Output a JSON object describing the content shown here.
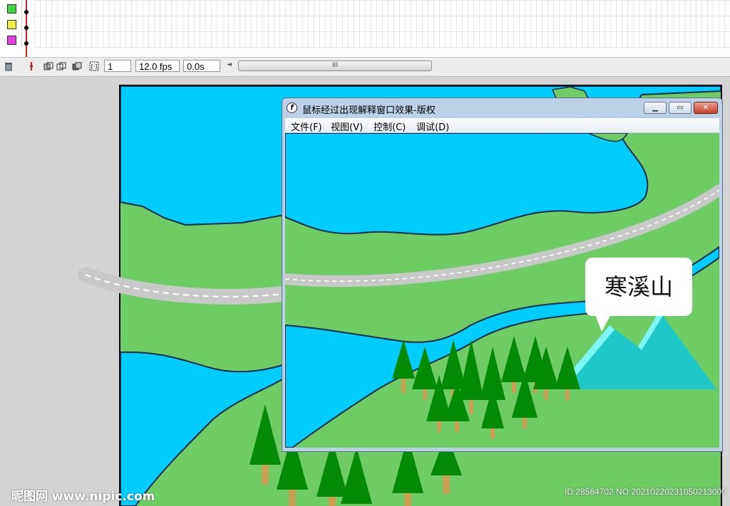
{
  "timeline": {
    "layer_colors": [
      "#42d442",
      "#f0f042",
      "#e040e0"
    ]
  },
  "toolbar": {
    "trash_icon": "trash-icon",
    "frame_number": "1",
    "fps": "12.0 fps",
    "elapsed": "0.0s",
    "scroll_grip": "III"
  },
  "popup_window": {
    "title": "鼠标经过出现解释窗口效果-版权",
    "app_icon": "flash-icon",
    "menu": [
      {
        "label": "文件(F)"
      },
      {
        "label": "视图(V)"
      },
      {
        "label": "控制(C)"
      },
      {
        "label": "调试(D)"
      }
    ],
    "minimize_icon": "minimize-icon",
    "maximize_icon": "maximize-icon",
    "close_icon": "close-icon"
  },
  "map": {
    "callout_text": "寒溪山",
    "colors": {
      "water": "#00ccff",
      "grass": "#6dcd64",
      "road": "#cccccc",
      "tree": "#058a05",
      "trunk": "#c8a050",
      "mountain": "#1ec8c8"
    }
  },
  "watermark": {
    "left": "昵图网 www.nipic.com",
    "right": "ID:28584702 NO:20210220231050213000"
  }
}
